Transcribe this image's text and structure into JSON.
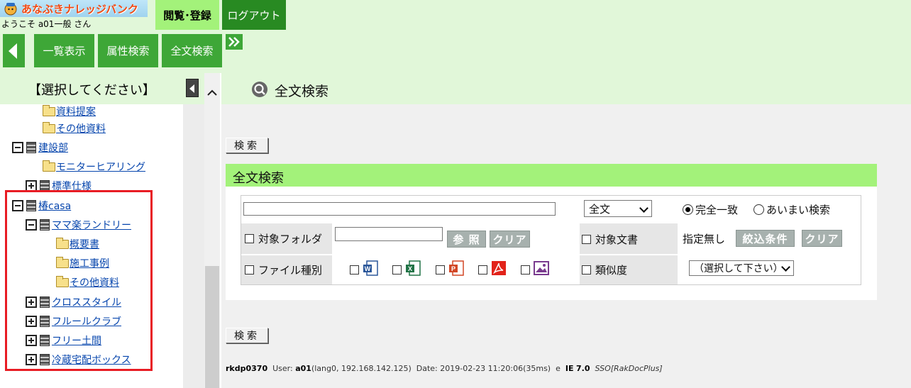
{
  "header": {
    "logo_text": "あなぶきナレッジバンク",
    "welcome": "ようこそ a01一般 さん",
    "view_register": "閲覧･登録",
    "logout": "ログアウト"
  },
  "nav": {
    "list_view": "一覧表示",
    "attr_search": "属性検索",
    "fulltext_search": "全文検索"
  },
  "sidebar": {
    "title": "【選択してください】",
    "tree": [
      {
        "label": "資料提案",
        "type": "folder"
      },
      {
        "label": "その他資料",
        "type": "folder"
      },
      {
        "label": "建設部",
        "type": "cabinet",
        "expanded": true
      },
      {
        "label": "モニターヒアリング",
        "type": "folder"
      },
      {
        "label": "標準仕様",
        "type": "cabinet",
        "expanded": false
      },
      {
        "label": "椿casa",
        "type": "cabinet",
        "expanded": true
      },
      {
        "label": "ママ楽ランドリー",
        "type": "cabinet",
        "expanded": true
      },
      {
        "label": "概要書",
        "type": "folder"
      },
      {
        "label": "施工事例",
        "type": "folder"
      },
      {
        "label": "その他資料",
        "type": "folder"
      },
      {
        "label": "クロススタイル",
        "type": "cabinet",
        "expanded": false
      },
      {
        "label": "フルールクラブ",
        "type": "cabinet",
        "expanded": false
      },
      {
        "label": "フリー土間",
        "type": "cabinet",
        "expanded": false
      },
      {
        "label": "冷蔵宅配ボックス",
        "type": "cabinet",
        "expanded": false
      }
    ]
  },
  "main": {
    "title": "全文検索",
    "search_button": "検索",
    "panel_title": "全文検索",
    "keyword_value": "",
    "scope_selected": "全文",
    "match_exact": "完全一致",
    "match_fuzzy": "あいまい検索",
    "match_selected": "exact",
    "target_folder_label": "対象フォルダ",
    "target_folder_value": "",
    "browse_button": "参 照",
    "clear_button": "クリア",
    "target_doc_label": "対象文書",
    "target_doc_value": "指定無し",
    "filter_button": "絞込条件",
    "file_type_label": "ファイル種別",
    "file_types": [
      "word-icon",
      "excel-icon",
      "powerpoint-icon",
      "pdf-icon",
      "image-icon"
    ],
    "similarity_label": "類似度",
    "similarity_selected": "（選択して下さい）"
  },
  "footer": {
    "code": "rkdp0370",
    "user_label": "User:",
    "user": "a01",
    "user_detail": "(lang0, 192.168.142.125)",
    "date_label": "Date:",
    "date": "2019-02-23 11:20:06(35ms)",
    "e": "e",
    "ie_label": "IE",
    "ie_version": "7.0",
    "sso": "SSO[RakDocPlus]"
  },
  "colors": {
    "header_bg": "#e1f7d9",
    "nav_green": "#3ea737",
    "active_green": "#a3f27a",
    "dark_green": "#288a22",
    "highlight_red": "#e81c24"
  }
}
